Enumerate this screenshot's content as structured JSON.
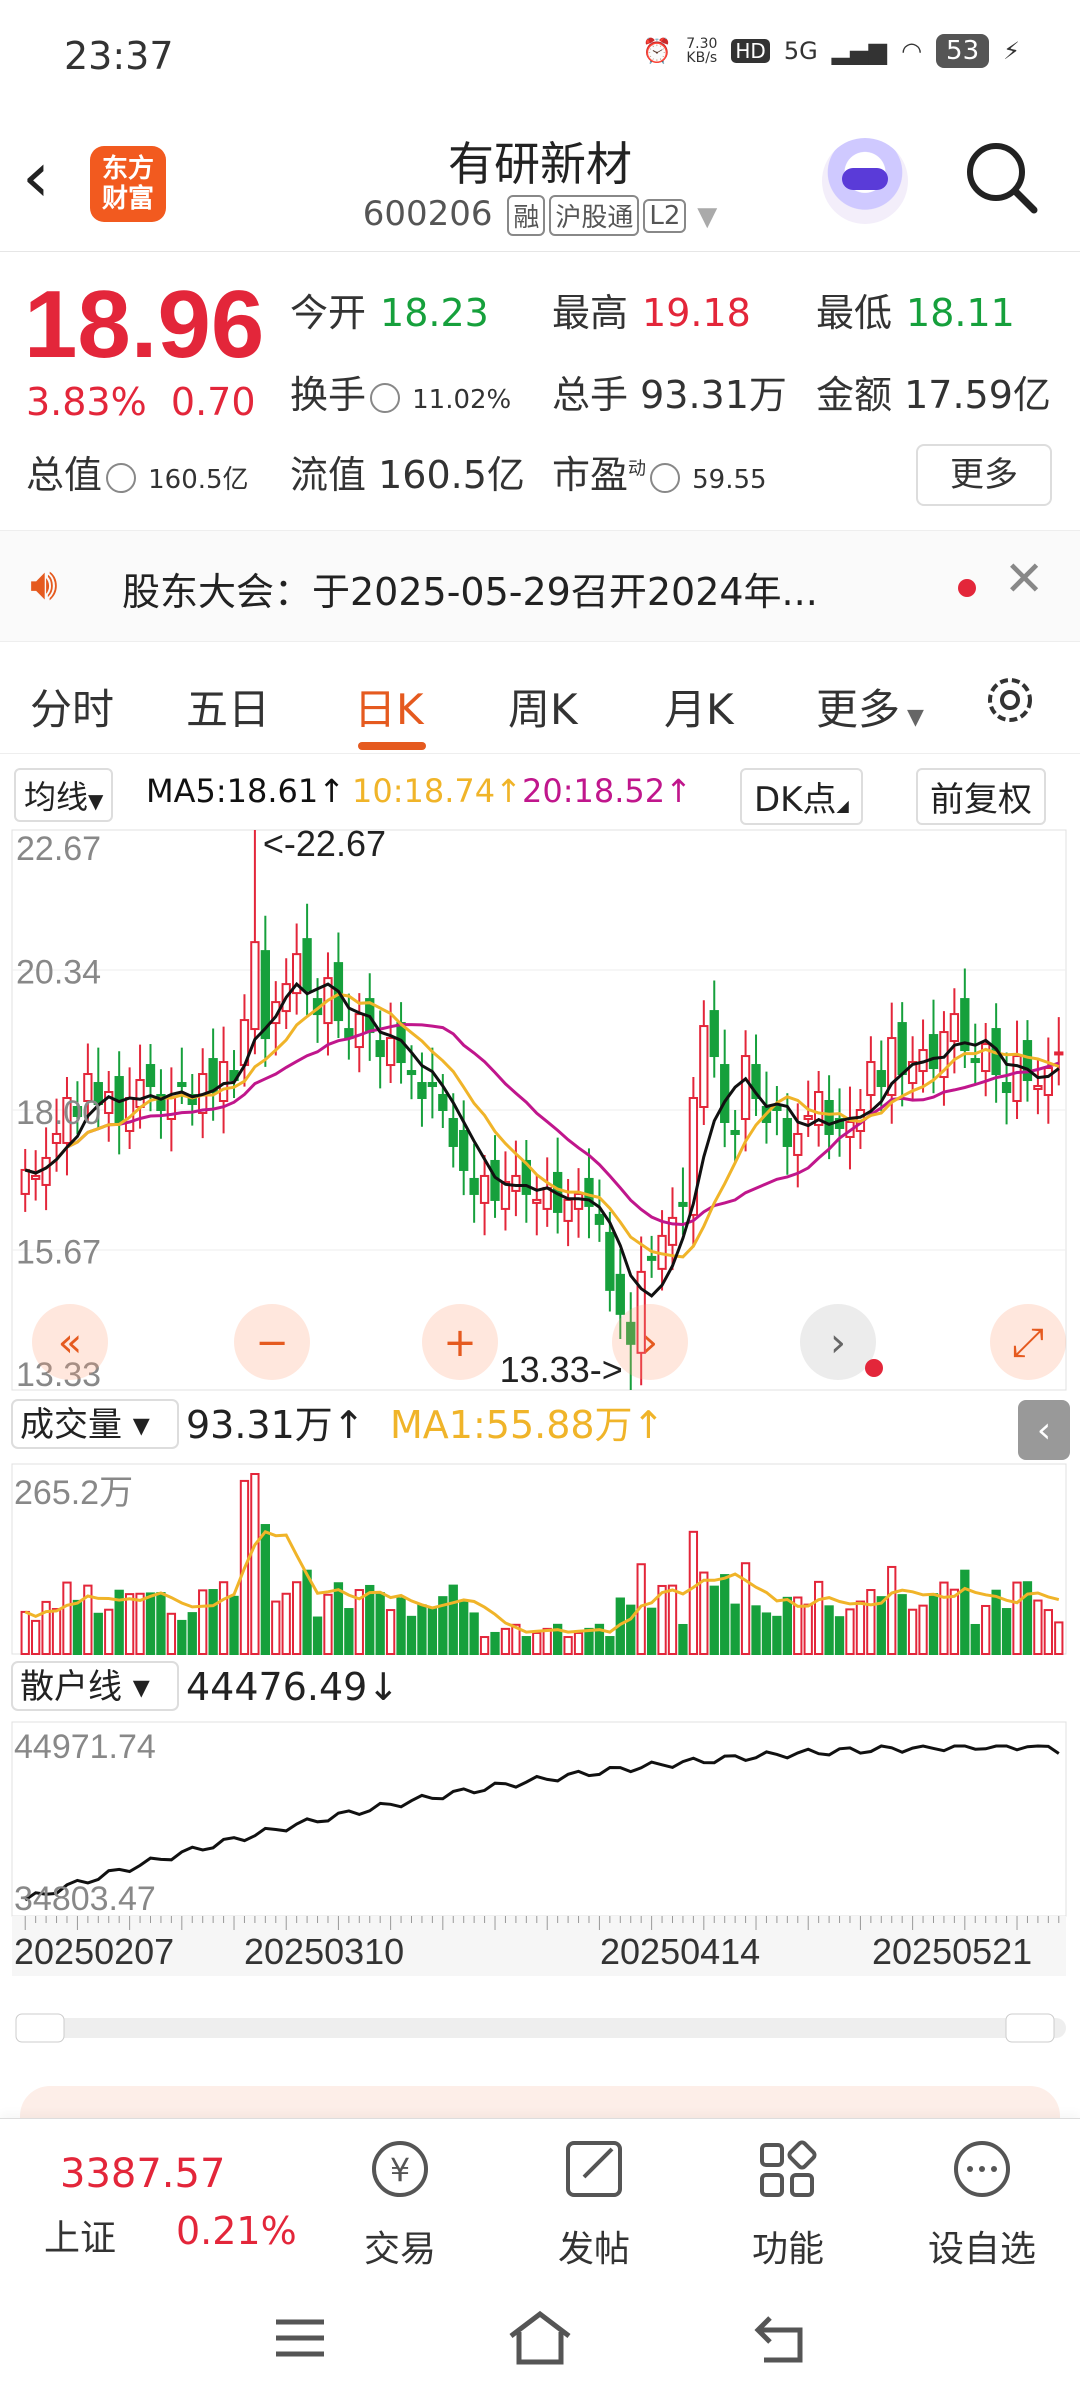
{
  "status": {
    "time": "23:37",
    "net_speed_top": "7.30",
    "net_speed_unit": "KB/s",
    "hd": "HD",
    "signal": "5G",
    "battery": "53"
  },
  "header": {
    "logo_line1": "东方",
    "logo_line2": "财富",
    "name": "有研新材",
    "code": "600206",
    "tags": [
      "融",
      "沪股通",
      "L2"
    ]
  },
  "quote": {
    "price": "18.96",
    "pct": "3.83%",
    "change": "0.70",
    "open_label": "今开",
    "open": "18.23",
    "high_label": "最高",
    "high": "19.18",
    "low_label": "最低",
    "low": "18.11",
    "turnover_label": "换手",
    "turnover": "11.02%",
    "volume_label": "总手",
    "volume": "93.31万",
    "amount_label": "金额",
    "amount": "17.59亿",
    "mcap_label": "总值",
    "mcap": "160.5亿",
    "float_label": "流值",
    "float": "160.5亿",
    "pe_label": "市盈",
    "pe_sup": "动",
    "pe": "59.55",
    "more": "更多"
  },
  "notice": {
    "text": "股东大会：于2025-05-29召开2024年..."
  },
  "tabs": [
    "分时",
    "五日",
    "日K",
    "周K",
    "月K",
    "更多"
  ],
  "active_tab": "日K",
  "ma": {
    "selector": "均线",
    "ma5": "MA5:18.61↑",
    "ma10": "10:18.74↑",
    "ma20": "20:18.52↑",
    "dk": "DK点",
    "adjust": "前复权"
  },
  "volume_panel": {
    "selector": "成交量",
    "value": "93.31万↑",
    "ma1": "MA1:55.88万↑"
  },
  "retail_panel": {
    "selector": "散户线",
    "value": "44476.49↓"
  },
  "chart_data": [
    {
      "type": "candlestick",
      "title": "日K",
      "ylim": [
        13.33,
        22.67
      ],
      "y_ticks": [
        "22.67",
        "20.34",
        "18.00",
        "15.67",
        "13.33"
      ],
      "x_ticks": [
        "20250207",
        "20250310",
        "20250414",
        "20250521"
      ],
      "annotations": [
        "<-22.67",
        "13.33->"
      ],
      "close": [
        17.0,
        16.9,
        17.2,
        17.6,
        18.2,
        17.9,
        18.6,
        18.1,
        18.3,
        17.8,
        18.2,
        18.5,
        18.4,
        18.0,
        18.2,
        18.4,
        18.1,
        18.6,
        18.3,
        18.8,
        18.5,
        19.5,
        20.8,
        19.2,
        19.8,
        20.1,
        20.6,
        20.0,
        19.6,
        20.2,
        19.5,
        19.2,
        19.6,
        19.3,
        18.9,
        19.2,
        18.8,
        18.6,
        18.2,
        18.4,
        18.0,
        17.4,
        17.0,
        16.6,
        16.9,
        16.5,
        16.8,
        16.9,
        16.6,
        16.5,
        16.7,
        16.3,
        16.5,
        16.6,
        16.4,
        16.1,
        15.0,
        14.6,
        14.1,
        15.3,
        15.5,
        15.9,
        16.2,
        16.4,
        18.2,
        19.4,
        18.9,
        17.8,
        17.6,
        18.9,
        18.2,
        17.8,
        18.0,
        17.4,
        17.6,
        17.9,
        18.3,
        17.6,
        17.7,
        17.8,
        18.0,
        18.8,
        18.4,
        19.2,
        18.6,
        18.8,
        19.0,
        18.7,
        19.3,
        19.6,
        19.0,
        18.8,
        19.1,
        18.6,
        18.3,
        18.9,
        18.5,
        18.4,
        18.7,
        18.96
      ],
      "series": [
        {
          "name": "MA5",
          "last": 18.61
        },
        {
          "name": "MA10",
          "last": 18.74
        },
        {
          "name": "MA20",
          "last": 18.52
        }
      ]
    },
    {
      "type": "bar",
      "title": "成交量",
      "y_ticks": [
        "265.2万"
      ],
      "last_value": "93.31万",
      "ma1": "55.88万"
    },
    {
      "type": "line",
      "title": "散户线",
      "y_ticks": [
        "44971.74",
        "34803.47"
      ],
      "last_value": "44476.49"
    }
  ],
  "nav": {
    "index_value": "3387.57",
    "index_name": "上证",
    "index_pct": "0.21%",
    "items": [
      "交易",
      "发帖",
      "功能",
      "设自选"
    ]
  },
  "colors": {
    "up": "#e3263a",
    "down": "#16a03c",
    "accent": "#e55a1f",
    "ma5": "#111111",
    "ma10": "#f0b429",
    "ma20": "#c0168c"
  }
}
